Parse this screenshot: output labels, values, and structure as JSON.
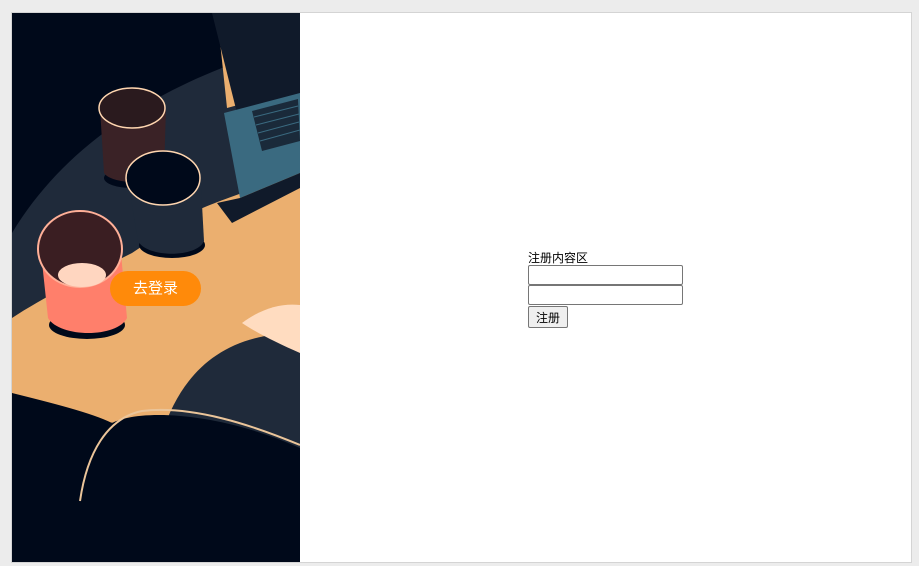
{
  "left_panel": {
    "go_login_label": "去登录"
  },
  "register": {
    "title": "注册内容区",
    "username_value": "",
    "password_value": "",
    "submit_label": "注册"
  },
  "colors": {
    "dark_navy": "#00091a",
    "slate": "#1f2a3a",
    "sand": "#ebaf6f",
    "orange_button": "#ff8a0a",
    "coral_cup": "#ff7f6b",
    "laptop_blue": "#3a6a80"
  }
}
